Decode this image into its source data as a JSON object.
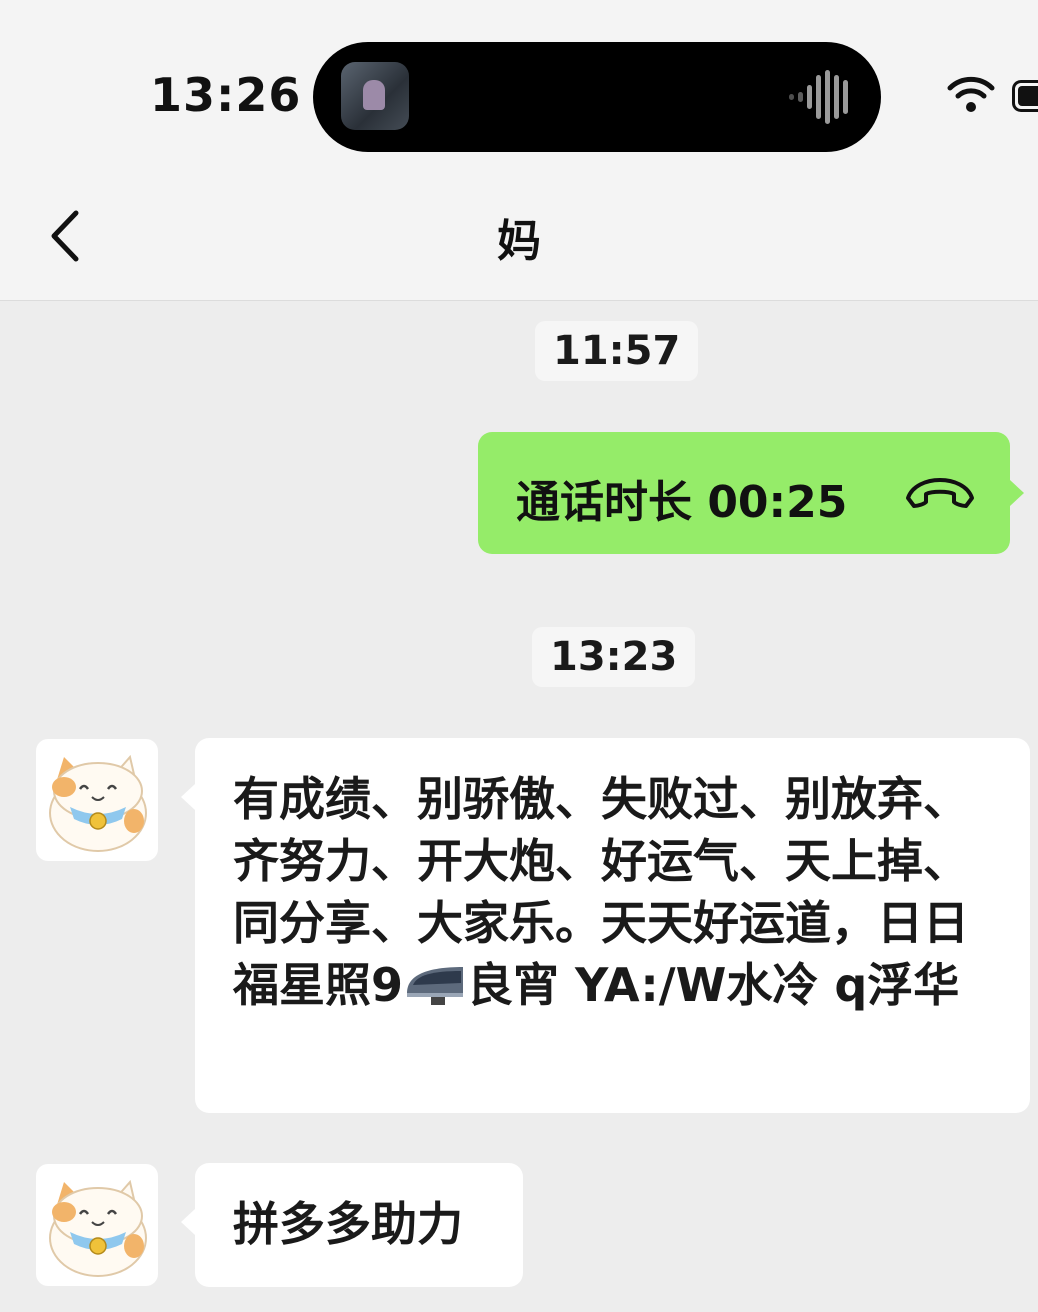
{
  "status_bar": {
    "time": "13:26",
    "icons": [
      "dynamic-island-media-thumbnail",
      "audio-waveform-icon",
      "wifi-icon",
      "battery-icon"
    ]
  },
  "nav": {
    "title": "妈",
    "back_icon": "chevron-left-icon"
  },
  "messages": [
    {
      "type": "timestamp",
      "text": "11:57"
    },
    {
      "type": "outgoing-call",
      "text": "通话时长 00:25",
      "icon": "phone-hangup-icon",
      "bubble_color": "#95ec69"
    },
    {
      "type": "timestamp",
      "text": "13:23"
    },
    {
      "type": "incoming",
      "avatar": "lucky-cat-avatar",
      "text_before_emoji": "有成绩、别骄傲、失败过、别放弃、齐努力、开大炮、好运气、天上掉、同分享、大家乐。天天好运道，日日福星照9",
      "emoji": "high-speed-train-emoji",
      "text_after_emoji": "良宵 YA:/W水冷 q浮华"
    },
    {
      "type": "incoming",
      "avatar": "lucky-cat-avatar",
      "text": "拼多多助力"
    }
  ],
  "colors": {
    "chat_background": "#ededed",
    "header_background": "#f4f4f4",
    "outgoing_bubble": "#95ec69",
    "incoming_bubble": "#ffffff"
  }
}
